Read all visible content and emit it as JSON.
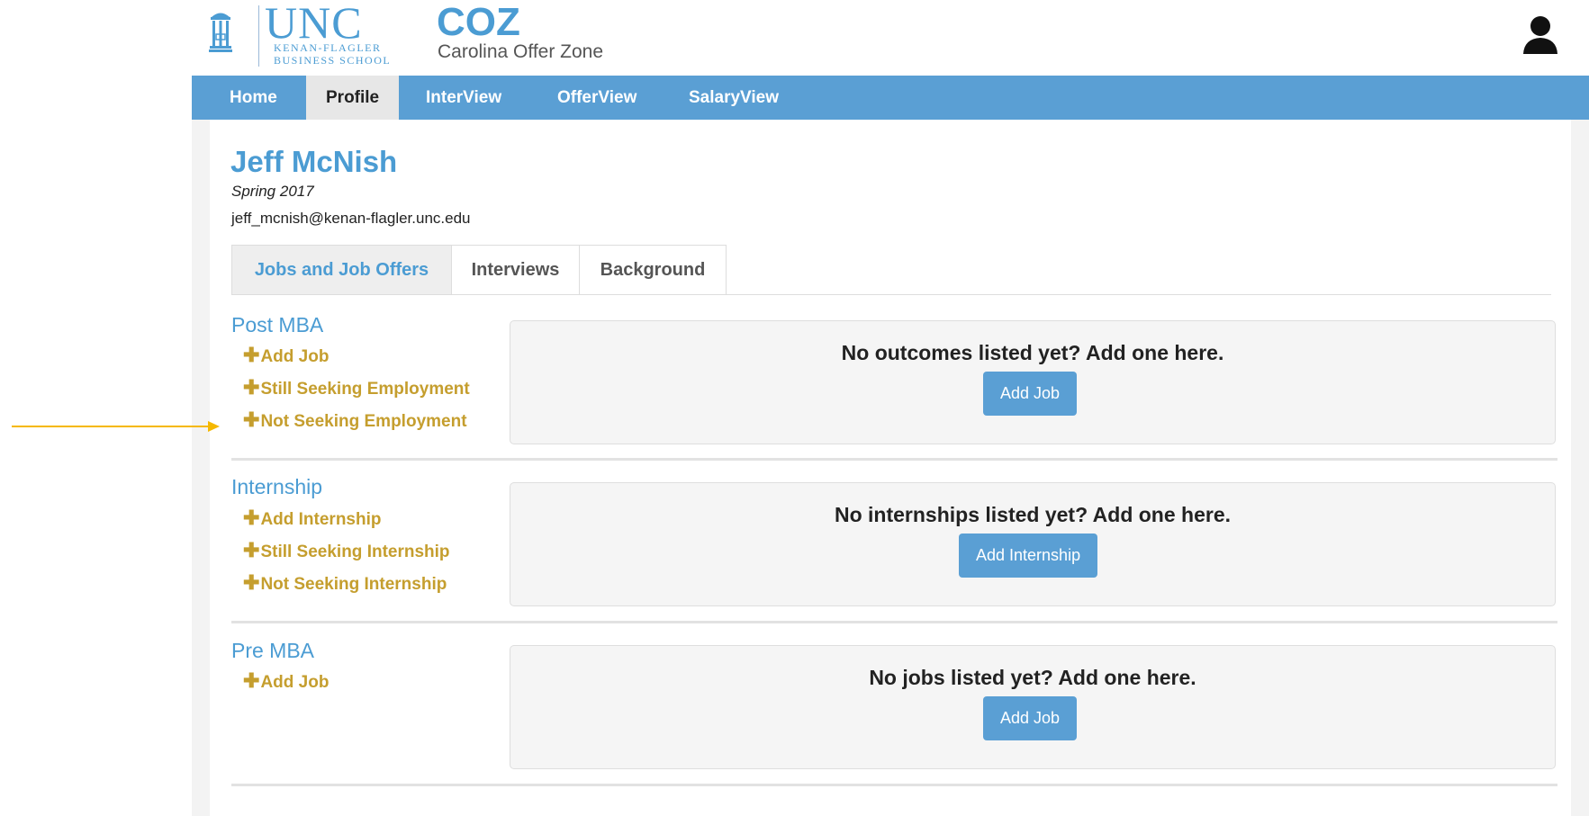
{
  "header": {
    "unc_logo_text": "UNC",
    "school_line_1": "KENAN-FLAGLER",
    "school_line_2": "BUSINESS SCHOOL",
    "app_title": "COZ",
    "app_subtitle": "Carolina Offer Zone"
  },
  "nav": {
    "items": [
      {
        "label": "Home"
      },
      {
        "label": "Profile"
      },
      {
        "label": "InterView"
      },
      {
        "label": "OfferView"
      },
      {
        "label": "SalaryView"
      }
    ],
    "active": "Profile"
  },
  "profile": {
    "name": "Jeff McNish",
    "term": "Spring 2017",
    "email": "jeff_mcnish@kenan-flagler.unc.edu"
  },
  "tabs": {
    "items": [
      {
        "label": "Jobs and Job Offers"
      },
      {
        "label": "Interviews"
      },
      {
        "label": "Background"
      }
    ],
    "active": "Jobs and Job Offers"
  },
  "sections": [
    {
      "title": "Post MBA",
      "links": [
        "Add Job",
        "Still Seeking Employment",
        "Not Seeking Employment"
      ],
      "empty_message": "No outcomes listed yet? Add one here.",
      "button_label": "Add Job"
    },
    {
      "title": "Internship",
      "links": [
        "Add Internship",
        "Still Seeking Internship",
        "Not Seeking Internship"
      ],
      "empty_message": "No internships listed yet? Add one here.",
      "button_label": "Add Internship"
    },
    {
      "title": "Pre MBA",
      "links": [
        "Add Job"
      ],
      "empty_message": "No jobs listed yet? Add one here.",
      "button_label": "Add Job"
    }
  ],
  "colors": {
    "brand_blue": "#4b9cd3",
    "nav_blue": "#5a9fd4",
    "link_gold": "#c59e2e",
    "annotation_arrow": "#f5b800"
  },
  "icons": {
    "user": "user-icon",
    "plus": "plus-icon",
    "logo": "old-well-icon"
  }
}
